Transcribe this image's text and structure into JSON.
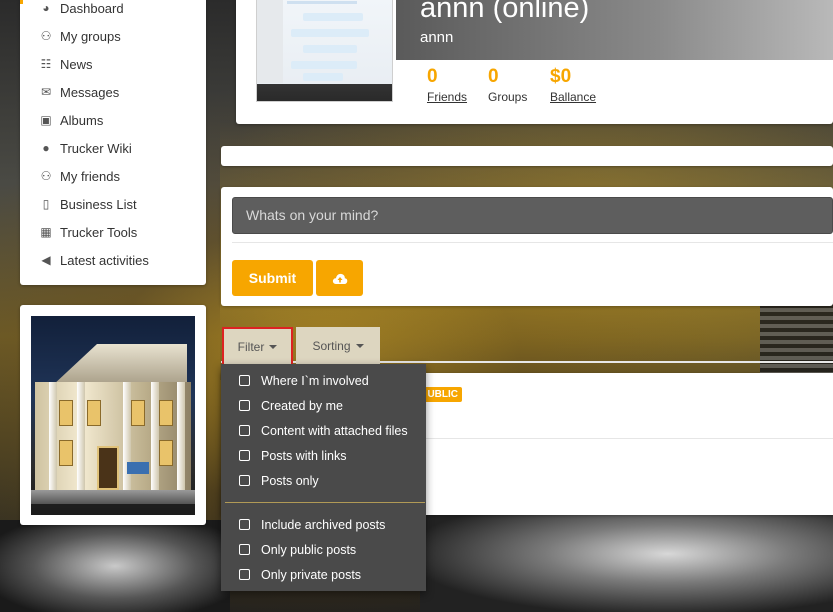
{
  "sidebar": {
    "items": [
      {
        "label": "Dashboard",
        "icon": "dashboard-icon",
        "glyph": "◕"
      },
      {
        "label": "My groups",
        "icon": "users-icon",
        "glyph": "⚇"
      },
      {
        "label": "News",
        "icon": "rss-icon",
        "glyph": "☷"
      },
      {
        "label": "Messages",
        "icon": "envelope-icon",
        "glyph": "✉"
      },
      {
        "label": "Albums",
        "icon": "camera-icon",
        "glyph": "▣"
      },
      {
        "label": "Trucker Wiki",
        "icon": "globe-icon",
        "glyph": "●"
      },
      {
        "label": "My friends",
        "icon": "users-icon",
        "glyph": "⚇"
      },
      {
        "label": "Business List",
        "icon": "building-icon",
        "glyph": "▯"
      },
      {
        "label": "Trucker Tools",
        "icon": "calculator-icon",
        "glyph": "▦"
      },
      {
        "label": "Latest activities",
        "icon": "megaphone-icon",
        "glyph": "◀"
      }
    ]
  },
  "profile": {
    "name": "annn (online)",
    "username": "annn",
    "stats": [
      {
        "value": "0",
        "label": "Friends",
        "link": true
      },
      {
        "value": "0",
        "label": "Groups",
        "link": false
      },
      {
        "value": "$0",
        "label": "Ballance",
        "link": true
      }
    ]
  },
  "composer": {
    "placeholder": "Whats on your mind?",
    "submit_label": "Submit",
    "upload_icon": "cloud-upload-icon"
  },
  "feed": {
    "filter_label": "Filter",
    "sorting_label": "Sorting",
    "badge": "UBLIC"
  },
  "filter_menu": {
    "group1": [
      {
        "label": "Where I`m involved",
        "checked": false
      },
      {
        "label": "Created by me",
        "checked": false
      },
      {
        "label": "Content with attached files",
        "checked": false
      },
      {
        "label": "Posts with links",
        "checked": false
      },
      {
        "label": "Posts only",
        "checked": false
      }
    ],
    "group2": [
      {
        "label": "Include archived posts",
        "checked": false
      },
      {
        "label": "Only public posts",
        "checked": false
      },
      {
        "label": "Only private posts",
        "checked": false
      }
    ]
  },
  "colors": {
    "accent": "#f7a600",
    "dropdown_bg": "#4a4a4a",
    "highlight_border": "#dd2222"
  }
}
